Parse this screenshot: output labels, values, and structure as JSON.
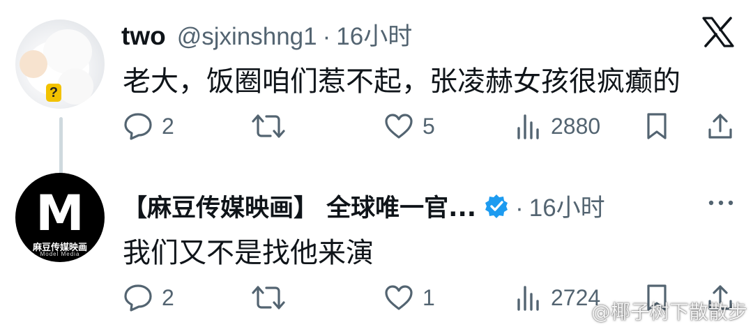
{
  "post1": {
    "name": "two",
    "handle": "@sjxinshng1",
    "sep": "·",
    "time": "16小时",
    "text": "老大，饭圈咱们惹不起，张凌赫女孩很疯癫的",
    "avatar_badge": "?",
    "actions": {
      "replies": "2",
      "retweets": "",
      "likes": "5",
      "views": "2880"
    }
  },
  "post2": {
    "name": "【麻豆传媒映画】 全球唯一官...",
    "sep": "·",
    "time": "16小时",
    "text": "我们又不是找他来演",
    "avatar_logo_letter": "M",
    "avatar_logo_cn": "麻豆传媒映画",
    "avatar_logo_en": "Model Media",
    "actions": {
      "replies": "2",
      "retweets": "",
      "likes": "1",
      "views": "2724"
    }
  },
  "header": {
    "logo_icon": "x-logo-icon"
  },
  "watermark": "@椰子树下散散步",
  "colors": {
    "text": "#0f1419",
    "secondary": "#536471",
    "verified": "#1d9bf0",
    "thread_line": "#cfd9de"
  }
}
